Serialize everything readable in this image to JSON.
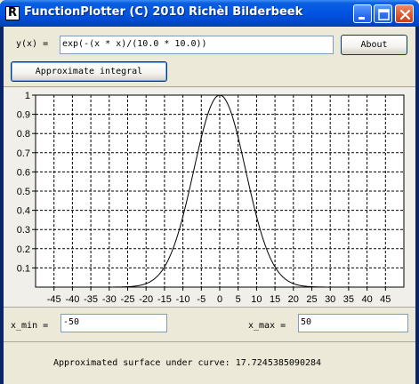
{
  "window": {
    "title": "FunctionPlotter (C) 2010 Richèl Bilderbeek",
    "icon_glyph": "R"
  },
  "function_row": {
    "label": "y(x) =",
    "value": "exp(-(x * x)/(10.0 * 10.0))",
    "about_label": "About"
  },
  "integral_button": {
    "label": "Approximate integral"
  },
  "range": {
    "x_min_label": "x_min =",
    "x_min_value": "-50",
    "x_max_label": "x_max =",
    "x_max_value": "50"
  },
  "result": {
    "text": "Approximated surface under curve: 17.7245385090284"
  },
  "chart_data": {
    "type": "line",
    "expression": "exp(-(x * x)/(10.0 * 10.0))",
    "xlim": [
      -50,
      50
    ],
    "ylim": [
      0,
      1
    ],
    "x_ticks": [
      -45,
      -40,
      -35,
      -30,
      -25,
      -20,
      -15,
      -10,
      -5,
      0,
      5,
      10,
      15,
      20,
      25,
      30,
      35,
      40,
      45
    ],
    "y_ticks": [
      0.1,
      0.2,
      0.3,
      0.4,
      0.5,
      0.6,
      0.7,
      0.8,
      0.9,
      1
    ],
    "grid": true,
    "series": [
      {
        "x": [
          -50,
          -40,
          -30,
          -25,
          -20,
          -15,
          -10,
          -5,
          0,
          5,
          10,
          15,
          20,
          25,
          30,
          40,
          50
        ],
        "y": [
          0,
          0,
          0.0001,
          0.0019,
          0.0183,
          0.1054,
          0.3679,
          0.7788,
          1,
          0.7788,
          0.3679,
          0.1054,
          0.0183,
          0.0019,
          0.0001,
          0,
          0
        ]
      }
    ],
    "colors": {
      "line": "#000000",
      "grid": "#000000",
      "background": "#ffffff"
    }
  }
}
